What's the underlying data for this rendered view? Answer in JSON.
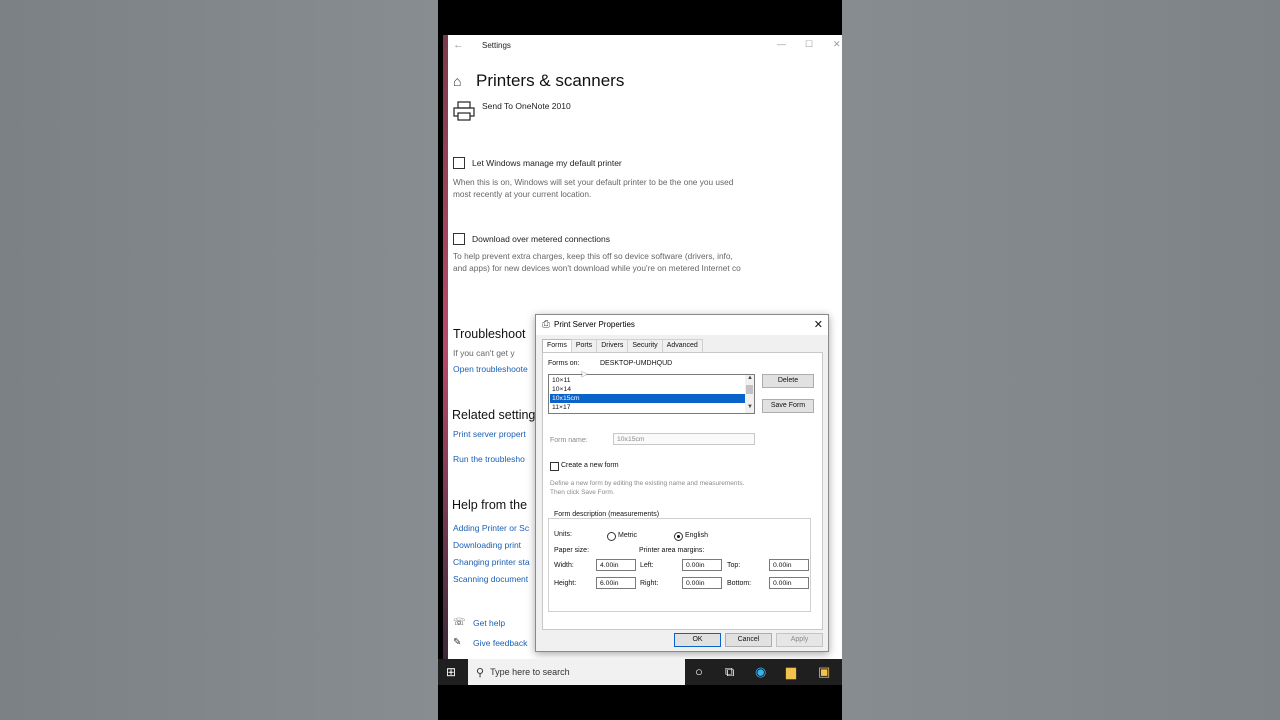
{
  "settings": {
    "title": "Settings",
    "page_title": "Printers & scanners",
    "printer_name": "Send To OneNote 2010",
    "default_printer": {
      "label": "Let Windows manage my default printer",
      "desc": "When this is on, Windows will set your default printer to be the one you used most recently at your current location."
    },
    "metered": {
      "label": "Download over metered connections",
      "desc": "To help prevent extra charges, keep this off so device software (drivers, info, and apps) for new devices won't download while you're on metered Internet co"
    },
    "troubleshoot": {
      "heading": "Troubleshoot",
      "text": "If you can't get y",
      "link": "Open troubleshoote"
    },
    "related": {
      "heading": "Related setting",
      "links": [
        "Print server propert",
        "Run the troublesho"
      ]
    },
    "help": {
      "heading": "Help from the",
      "links": [
        "Adding Printer or Sc",
        "Downloading print",
        "Changing printer sta",
        "Scanning document"
      ]
    },
    "get_help": "Get help",
    "give_feedback": "Give feedback"
  },
  "taskbar": {
    "search_placeholder": "Type here to search"
  },
  "dialog": {
    "title": "Print Server Properties",
    "tabs": [
      "Forms",
      "Ports",
      "Drivers",
      "Security",
      "Advanced"
    ],
    "forms_on_label": "Forms on:",
    "forms_on_value": "DESKTOP-UMDHQUD",
    "forms_list": [
      "10×11",
      "10×14",
      "10x15cm",
      "11×17"
    ],
    "selected_form": "10x15cm",
    "delete_label": "Delete",
    "save_form_label": "Save Form",
    "form_name_label": "Form name:",
    "form_name_value": "10x15cm",
    "create_new_label": "Create a new form",
    "create_new_desc": "Define a new form by editing the existing name and measurements. Then click Save Form.",
    "measurements_label": "Form description (measurements)",
    "units_label": "Units:",
    "metric_label": "Metric",
    "english_label": "English",
    "paper_size_label": "Paper size:",
    "margins_label": "Printer area margins:",
    "width_label": "Width:",
    "width_value": "4.00in",
    "height_label": "Height:",
    "height_value": "6.00in",
    "left_label": "Left:",
    "left_value": "0.00in",
    "right_label": "Right:",
    "right_value": "0.00in",
    "top_label": "Top:",
    "top_value": "0.00in",
    "bottom_label": "Bottom:",
    "bottom_value": "0.00in",
    "ok_label": "OK",
    "cancel_label": "Cancel",
    "apply_label": "Apply"
  }
}
